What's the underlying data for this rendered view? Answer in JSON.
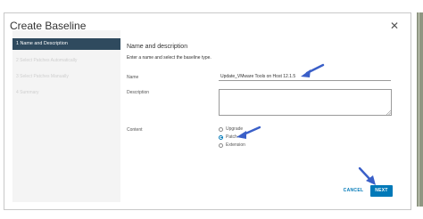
{
  "dialog": {
    "title": "Create Baseline",
    "close_icon": "close-icon"
  },
  "sidebar": {
    "steps": [
      {
        "label": "1  Name and Description",
        "active": true
      },
      {
        "label": "2  Select Patches Automatically",
        "active": false
      },
      {
        "label": "3  Select Patches Manually",
        "active": false
      },
      {
        "label": "4  Summary",
        "active": false
      }
    ]
  },
  "content": {
    "title": "Name and description",
    "instructions": "Enter a name and select the baseline type.",
    "name_label": "Name",
    "name_value": "Update_VMware Tools on Host 12.1.5",
    "description_label": "Description",
    "description_value": "",
    "content_label": "Content",
    "options": [
      {
        "label": "Upgrade",
        "checked": false
      },
      {
        "label": "Patch",
        "checked": true
      },
      {
        "label": "Extension",
        "checked": false
      }
    ]
  },
  "footer": {
    "cancel_label": "CANCEL",
    "next_label": "NEXT"
  },
  "colors": {
    "accent": "#0079b8",
    "sidebar_active": "#2f4a5e",
    "annotation_arrow": "#3a5fc8"
  }
}
